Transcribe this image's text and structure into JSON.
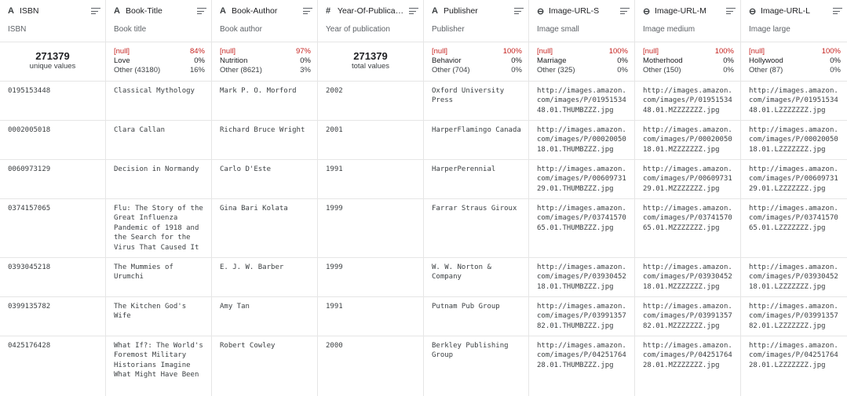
{
  "columns": [
    {
      "type_icon": "A",
      "name": "ISBN",
      "desc": "ISBN"
    },
    {
      "type_icon": "A",
      "name": "Book-Title",
      "desc": "Book title"
    },
    {
      "type_icon": "A",
      "name": "Book-Author",
      "desc": "Book author"
    },
    {
      "type_icon": "#",
      "name": "Year-Of-Publicati...",
      "desc": "Year of publication"
    },
    {
      "type_icon": "A",
      "name": "Publisher",
      "desc": "Publisher"
    },
    {
      "type_icon": "⊖",
      "name": "Image-URL-S",
      "desc": "Image small"
    },
    {
      "type_icon": "⊖",
      "name": "Image-URL-M",
      "desc": "Image medium"
    },
    {
      "type_icon": "⊖",
      "name": "Image-URL-L",
      "desc": "Image large"
    }
  ],
  "stats": {
    "isbn": {
      "number": "271379",
      "label": "unique values"
    },
    "title": [
      [
        "[null]",
        "84%"
      ],
      [
        "Love",
        "0%"
      ],
      [
        "Other (43180)",
        "16%"
      ]
    ],
    "author": [
      [
        "[null]",
        "97%"
      ],
      [
        "Nutrition",
        "0%"
      ],
      [
        "Other (8621)",
        "3%"
      ]
    ],
    "year": {
      "number": "271379",
      "label": "total values"
    },
    "publisher": [
      [
        "[null]",
        "100%"
      ],
      [
        "Behavior",
        "0%"
      ],
      [
        "Other (704)",
        "0%"
      ]
    ],
    "url_s": [
      [
        "[null]",
        "100%"
      ],
      [
        "Marriage",
        "0%"
      ],
      [
        "Other (325)",
        "0%"
      ]
    ],
    "url_m": [
      [
        "[null]",
        "100%"
      ],
      [
        "Motherhood",
        "0%"
      ],
      [
        "Other (150)",
        "0%"
      ]
    ],
    "url_l": [
      [
        "[null]",
        "100%"
      ],
      [
        "Hollywood",
        "0%"
      ],
      [
        "Other (87)",
        "0%"
      ]
    ]
  },
  "rows": [
    [
      "0195153448",
      "Classical Mythology",
      "Mark P. O. Morford",
      "2002",
      "Oxford University Press",
      "http://images.amazon.com/images/P/0195153448.01.THUMBZZZ.jpg",
      "http://images.amazon.com/images/P/0195153448.01.MZZZZZZZ.jpg",
      "http://images.amazon.com/images/P/0195153448.01.LZZZZZZZ.jpg"
    ],
    [
      "0002005018",
      "Clara Callan",
      "Richard Bruce Wright",
      "2001",
      "HarperFlamingo Canada",
      "http://images.amazon.com/images/P/0002005018.01.THUMBZZZ.jpg",
      "http://images.amazon.com/images/P/0002005018.01.MZZZZZZZ.jpg",
      "http://images.amazon.com/images/P/0002005018.01.LZZZZZZZ.jpg"
    ],
    [
      "0060973129",
      "Decision in Normandy",
      "Carlo D'Este",
      "1991",
      "HarperPerennial",
      "http://images.amazon.com/images/P/0060973129.01.THUMBZZZ.jpg",
      "http://images.amazon.com/images/P/0060973129.01.MZZZZZZZ.jpg",
      "http://images.amazon.com/images/P/0060973129.01.LZZZZZZZ.jpg"
    ],
    [
      "0374157065",
      "Flu: The Story of the Great Influenza Pandemic of 1918 and the Search for the Virus That Caused It",
      "Gina Bari Kolata",
      "1999",
      "Farrar Straus Giroux",
      "http://images.amazon.com/images/P/0374157065.01.THUMBZZZ.jpg",
      "http://images.amazon.com/images/P/0374157065.01.MZZZZZZZ.jpg",
      "http://images.amazon.com/images/P/0374157065.01.LZZZZZZZ.jpg"
    ],
    [
      "0393045218",
      "The Mummies of Urumchi",
      "E. J. W. Barber",
      "1999",
      "W. W. Norton & Company",
      "http://images.amazon.com/images/P/0393045218.01.THUMBZZZ.jpg",
      "http://images.amazon.com/images/P/0393045218.01.MZZZZZZZ.jpg",
      "http://images.amazon.com/images/P/0393045218.01.LZZZZZZZ.jpg"
    ],
    [
      "0399135782",
      "The Kitchen God's Wife",
      "Amy Tan",
      "1991",
      "Putnam Pub Group",
      "http://images.amazon.com/images/P/0399135782.01.THUMBZZZ.jpg",
      "http://images.amazon.com/images/P/0399135782.01.MZZZZZZZ.jpg",
      "http://images.amazon.com/images/P/0399135782.01.LZZZZZZZ.jpg"
    ],
    [
      "0425176428",
      "What If?: The World's Foremost Military Historians Imagine What Might Have Been",
      "Robert Cowley",
      "2000",
      "Berkley Publishing Group",
      "http://images.amazon.com/images/P/0425176428.01.THUMBZZZ.jpg",
      "http://images.amazon.com/images/P/0425176428.01.MZZZZZZZ.jpg",
      "http://images.amazon.com/images/P/0425176428.01.LZZZZZZZ.jpg"
    ]
  ],
  "colors": {
    "null": "#c5221f",
    "border": "#e6e6e6",
    "muted": "#5f6368"
  }
}
